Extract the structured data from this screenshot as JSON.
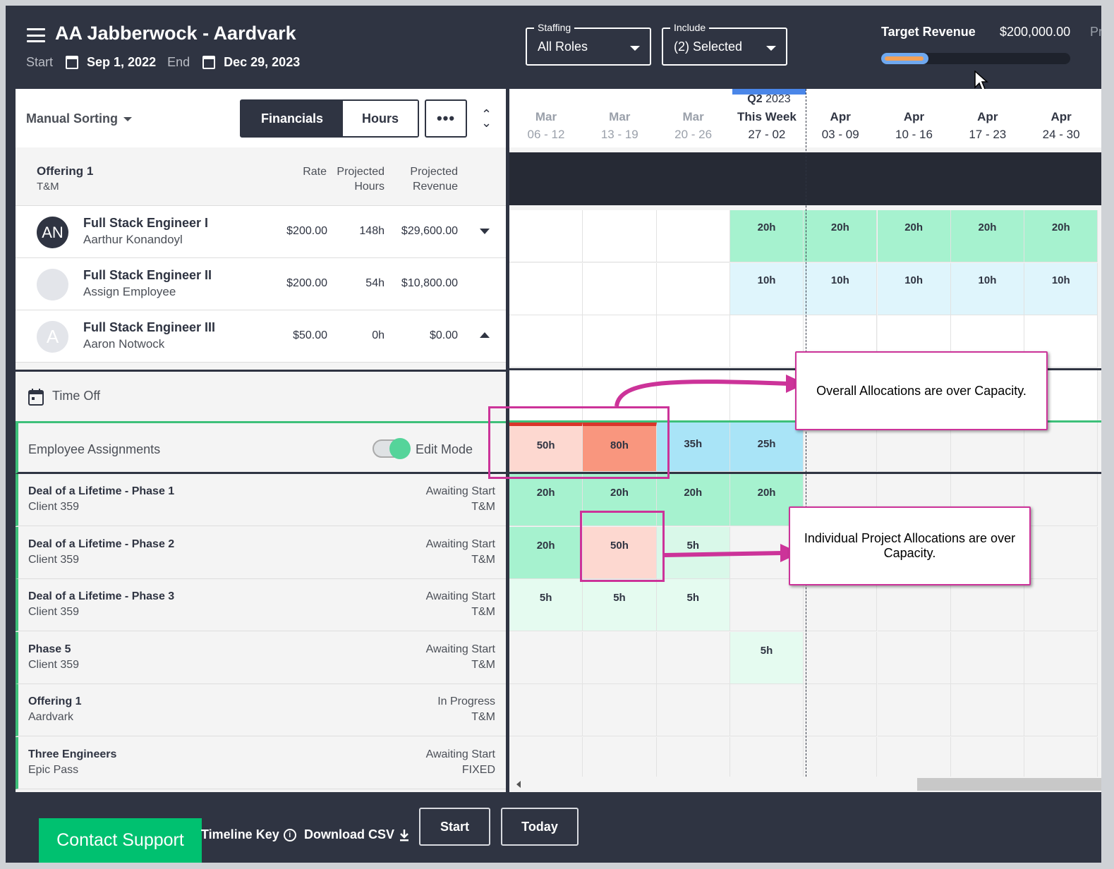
{
  "header": {
    "title": "AA Jabberwock - Aardvark",
    "start_label": "Start",
    "start_date": "Sep 1, 2022",
    "end_label": "End",
    "end_date": "Dec 29, 2023",
    "staffing": {
      "label": "Staffing",
      "value": "All Roles"
    },
    "include": {
      "label": "Include",
      "value": "(2) Selected"
    },
    "target_revenue_label": "Target Revenue",
    "target_revenue_value": "$200,000.00",
    "cutoff_text": "Pr",
    "target_progress_fraction": 0.25
  },
  "toolbar": {
    "sort_label": "Manual Sorting",
    "financials_label": "Financials",
    "hours_label": "Hours",
    "more_label": "•••"
  },
  "offering": {
    "name": "Offering 1",
    "type": "T&M",
    "col_rate": "Rate",
    "col_proj_hours_1": "Projected",
    "col_proj_hours_2": "Hours",
    "col_proj_rev_1": "Projected",
    "col_proj_rev_2": "Revenue"
  },
  "roles": [
    {
      "title": "Full Stack Engineer I",
      "person": "Aarthur Konandoyl",
      "initials": "AN",
      "rate": "$200.00",
      "hours": "148h",
      "revenue": "$29,600.00"
    },
    {
      "title": "Full Stack Engineer II",
      "person": "Assign Employee",
      "initials": "",
      "rate": "$200.00",
      "hours": "54h",
      "revenue": "$10,800.00"
    },
    {
      "title": "Full Stack Engineer III",
      "person": "Aaron Notwock",
      "initials": "A",
      "rate": "$50.00",
      "hours": "0h",
      "revenue": "$0.00"
    }
  ],
  "time_off_label": "Time Off",
  "employee_assignments": {
    "label": "Employee Assignments",
    "edit_mode_label": "Edit Mode"
  },
  "projects": [
    {
      "name": "Deal of a Lifetime - Phase 1",
      "client": "Client 359",
      "status": "Awaiting Start",
      "type": "T&M"
    },
    {
      "name": "Deal of a Lifetime - Phase 2",
      "client": "Client 359",
      "status": "Awaiting Start",
      "type": "T&M"
    },
    {
      "name": "Deal of a Lifetime - Phase 3",
      "client": "Client 359",
      "status": "Awaiting Start",
      "type": "T&M"
    },
    {
      "name": "Phase 5",
      "client": "Client 359",
      "status": "Awaiting Start",
      "type": "T&M"
    },
    {
      "name": "Offering 1",
      "client": "Aardvark",
      "status": "In Progress",
      "type": "T&M"
    },
    {
      "name": "Three Engineers",
      "client": "Epic Pass",
      "status": "Awaiting Start",
      "type": "FIXED"
    }
  ],
  "timeline": {
    "quarter_label": "Q2",
    "quarter_year": "2023",
    "weeks": [
      {
        "month": "Mar",
        "range": "06 - 12"
      },
      {
        "month": "Mar",
        "range": "13 - 19"
      },
      {
        "month": "Mar",
        "range": "20 - 26"
      },
      {
        "month": "This Week",
        "range": "27 - 02"
      },
      {
        "month": "Apr",
        "range": "03 - 09"
      },
      {
        "month": "Apr",
        "range": "10 - 16"
      },
      {
        "month": "Apr",
        "range": "17 - 23"
      },
      {
        "month": "Apr",
        "range": "24 - 30"
      }
    ],
    "role_hours": [
      [
        "",
        "",
        "",
        "20h",
        "20h",
        "20h",
        "20h",
        "20h"
      ],
      [
        "",
        "",
        "",
        "10h",
        "10h",
        "10h",
        "10h",
        "10h"
      ],
      [
        "",
        "",
        "",
        "",
        "",
        "",
        "",
        ""
      ]
    ],
    "assignment_totals": [
      "50h",
      "80h",
      "35h",
      "25h",
      "",
      "",
      "",
      ""
    ],
    "project_hours": [
      [
        "20h",
        "20h",
        "20h",
        "20h",
        "",
        "",
        "",
        ""
      ],
      [
        "20h",
        "50h",
        "5h",
        "",
        "",
        "",
        "",
        ""
      ],
      [
        "5h",
        "5h",
        "5h",
        "",
        "",
        "",
        "",
        ""
      ],
      [
        "",
        "",
        "",
        "5h",
        "",
        "",
        "",
        ""
      ],
      [
        "",
        "",
        "",
        "",
        "",
        "",
        "",
        ""
      ],
      [
        "",
        "",
        "",
        "",
        "",
        "",
        "",
        ""
      ]
    ]
  },
  "annotations": {
    "overall": "Overall Allocations are over Capacity.",
    "individual": "Individual Project Allocations are over Capacity."
  },
  "footer": {
    "support": "Contact Support",
    "timeline_key": "Timeline Key",
    "download_csv": "Download CSV",
    "start": "Start",
    "today": "Today"
  }
}
